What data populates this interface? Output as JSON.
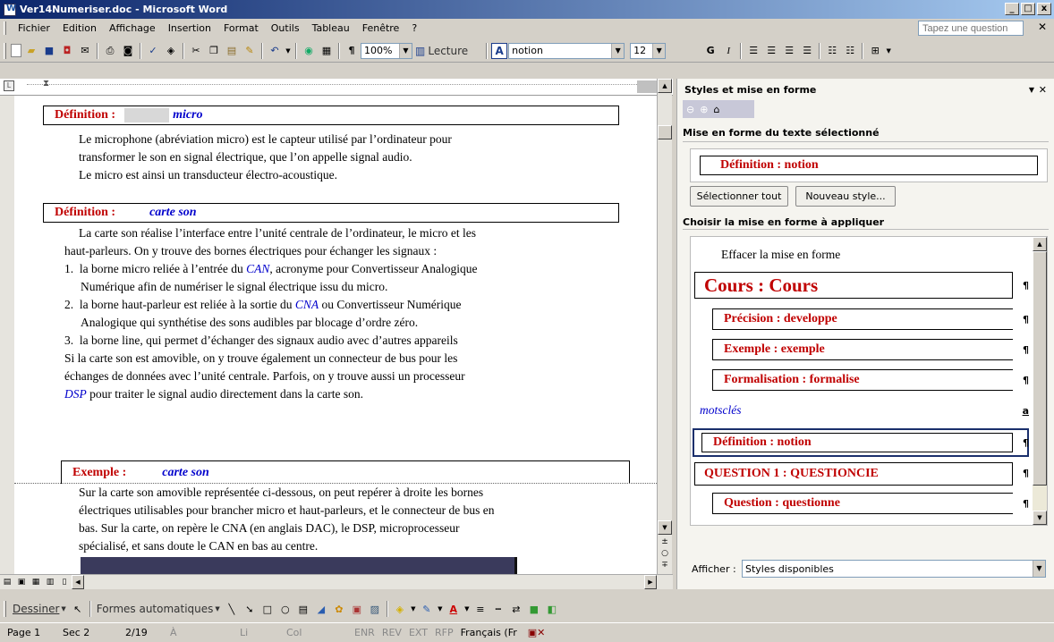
{
  "window": {
    "title": "Ver14Numeriser.doc - Microsoft Word",
    "min": "_",
    "max": "□",
    "close": "x"
  },
  "menu": {
    "items": [
      "Fichier",
      "Edition",
      "Affichage",
      "Insertion",
      "Format",
      "Outils",
      "Tableau",
      "Fenêtre",
      "?"
    ],
    "help_placeholder": "Tapez une question"
  },
  "toolbar": {
    "zoom": "100%",
    "reading": "Lecture",
    "style": "notion",
    "font_size": "12",
    "bold": "G",
    "italic": "I"
  },
  "document": {
    "def1": {
      "label": "Définition :",
      "term": "micro"
    },
    "p1": [
      "Le microphone (abréviation micro) est le capteur utilisé par l’ordinateur pour",
      "transformer le son en signal électrique, que l’on appelle signal audio.",
      "Le micro est ainsi un transducteur électro-acoustique."
    ],
    "def2": {
      "label": "Définition :",
      "term": "carte son"
    },
    "p2": [
      "La carte son réalise l’interface entre l’unité centrale de l’ordinateur, le micro et les",
      "haut-parleurs. On y trouve des bornes électriques pour échanger les signaux :"
    ],
    "list": [
      {
        "num": "1.",
        "pre": "la borne micro reliée à l’entrée du ",
        "link": "CAN",
        "post": ", acronyme pour Convertisseur Analogique",
        "cont": "Numérique afin de numériser le signal électrique issu du micro."
      },
      {
        "num": "2.",
        "pre": "la borne haut-parleur est reliée à la sortie du ",
        "link": "CNA",
        "post": "  ou Convertisseur Numérique",
        "cont": "Analogique qui synthétise des sons audibles par blocage d’ordre zéro."
      },
      {
        "num": "3.",
        "pre": "la borne line, qui permet d’échanger des signaux audio avec d’autres appareils",
        "link": "",
        "post": "",
        "cont": ""
      }
    ],
    "p3": [
      "Si la carte son est amovible, on y trouve également un connecteur de bus pour les",
      "échanges de données avec l’unité centrale. Parfois, on y trouve aussi un processeur"
    ],
    "p3_link": "DSP",
    "p3_end": " pour traiter le signal audio directement dans la carte son.",
    "ex": {
      "label": "Exemple :",
      "term": "carte son"
    },
    "p4": [
      "Sur la carte son amovible représentée ci-dessous, on peut repérer à droite les bornes",
      "électriques utilisables pour brancher micro et haut-parleurs, et le connecteur de bus en",
      "bas. Sur la carte, on repère le CNA (en anglais DAC), le DSP, microprocesseur",
      "spécialisé, et sans doute le CAN  en bas au centre."
    ]
  },
  "pane": {
    "title": "Styles et mise en forme",
    "selected_heading": "Mise en forme du texte sélectionné",
    "selected_style": "Définition :  notion",
    "select_all": "Sélectionner tout",
    "new_style": "Nouveau style...",
    "apply_heading": "Choisir la mise en forme à appliquer",
    "clear": "Effacer la mise en forme",
    "styles": [
      {
        "label": "Cours :   Cours",
        "mark": "¶"
      },
      {
        "label": "Précision :  developpe",
        "mark": "¶"
      },
      {
        "label": "Exemple :  exemple",
        "mark": "¶"
      },
      {
        "label": "Formalisation :  formalise",
        "mark": "¶"
      },
      {
        "label": "motsclés",
        "mark": "a"
      },
      {
        "label": "Définition :  notion",
        "mark": "¶"
      },
      {
        "label": "QUESTION 1 :   QUESTIONCIE",
        "mark": "¶"
      },
      {
        "label": "Question :  questionne",
        "mark": "¶"
      }
    ],
    "show_label": "Afficher :",
    "show_value": "Styles disponibles"
  },
  "drawing": {
    "draw": "Dessiner",
    "autoshapes": "Formes automatiques"
  },
  "status": {
    "page": "Page 1",
    "sec": "Sec 2",
    "pages": "2/19",
    "at": "À",
    "li": "Li",
    "col": "Col",
    "enr": "ENR",
    "rev": "REV",
    "ext": "EXT",
    "rfp": "RFP",
    "lang": "Français (Fr"
  }
}
